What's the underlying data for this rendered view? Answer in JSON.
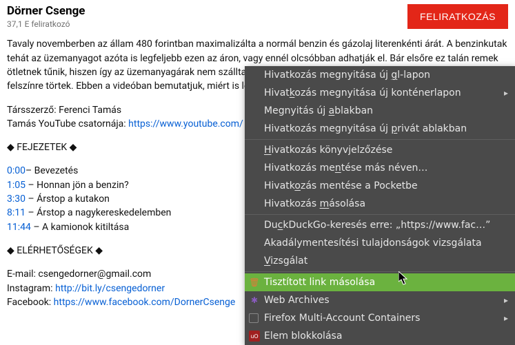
{
  "header": {
    "channel_name": "Dörner Csenge",
    "subs": "37,1 E feliratkozó",
    "subscribe_label": "FELIRATKOZÁS"
  },
  "desc": {
    "paragraph": "Tavaly novemberben az állam 480 forintban maximalizálta a normál benzin és gázolaj literenkénti árát. A benzinkutak tehát az üzemanyagot azóta is legfeljebb ezen az áron, vagy ennél olcsóbban adhatják el. Bár elsőre ez talán remek ötletnek tűnik, hiszen így az üzemanyagárak nem szálltak el, az ár problémái az elmúlt hetekben egyre inkább felszínre törtek. Ebben a videóban bemutatjuk, miért is lehet veszélyes, ha a piaci folyamatokba beleavatkoznak.",
    "coauthor_label": "Társszerző: ",
    "coauthor_name": "Ferenci Tamás",
    "tamas_label": "Tamás YouTube csatornája: ",
    "tamas_link": "https://www.youtube.com/",
    "chapters_heading": "◆ FEJEZETEK ◆",
    "chapters": [
      {
        "t": "0:00",
        "sep": "– ",
        "title": "Bevezetés"
      },
      {
        "t": "1:05",
        "sep": " – ",
        "title": "Honnan jön a benzin?"
      },
      {
        "t": "3:30",
        "sep": " – ",
        "title": "Árstop a kutakon"
      },
      {
        "t": "8:11",
        "sep": " – ",
        "title": "Árstop a nagykereskedelemben"
      },
      {
        "t": "11:44",
        "sep": "  – ",
        "title": "A kamionok kitiltása"
      }
    ],
    "contacts_heading": "◆ ELÉRHETŐSÉGEK ◆",
    "contacts": {
      "email_label": "E-mail: ",
      "email": "csengedorner@gmail.com",
      "instagram_label": "Instagram: ",
      "instagram": "http://bit.ly/csengedorner",
      "facebook_label": "Facebook: ",
      "facebook": "https://www.facebook.com/DornerCsenge"
    }
  },
  "contextmenu": {
    "items": [
      {
        "pre": "Hivatkozás megnyitása új ",
        "u": "",
        "post": "",
        "u2": "g",
        "post2": "l-lapon"
      },
      {
        "pre": "Hivat",
        "u": "k",
        "post": "ozás megnyitása új konténerlapon",
        "arrow": true
      },
      {
        "pre": "Megnyitás új ",
        "u": "a",
        "post": "blakban"
      },
      {
        "pre": "Hivatkozás megnyitása új ",
        "u": "p",
        "post": "rivát ablakban"
      },
      {
        "sep": true
      },
      {
        "pre": "",
        "u": "H",
        "post": "ivatkozás könyvjelzőzése"
      },
      {
        "pre": "Hivatkozás me",
        "u": "n",
        "post": "tése más néven…"
      },
      {
        "pre": "Hivatk",
        "u": "o",
        "post": "zás mentése a Pocketbe"
      },
      {
        "pre": "Hivatkozás ",
        "u": "m",
        "post": "ásolása"
      },
      {
        "sep": true
      },
      {
        "pre": "Du",
        "u": "c",
        "post": "kDuckGo-keresés erre: „https://www.fac…”"
      },
      {
        "pre": "Akadálymentesítési tulajdonságok vizsgálata"
      },
      {
        "pre": "",
        "u": "V",
        "post": "izsgálat"
      },
      {
        "sep": true
      },
      {
        "pre": "Tisztított link másolása",
        "highlight": true,
        "icon_color": "#e07b3a",
        "icon": "🗑"
      },
      {
        "pre": "Web Archives",
        "arrow": true,
        "icon_color": "#8a5bbf",
        "icon": "✱"
      },
      {
        "pre": "Firefox Multi-Account Containers",
        "arrow": true,
        "icon_box": true
      },
      {
        "pre": "Elem blokkolása",
        "icon_color": "#a02020",
        "icon_bg": true
      }
    ]
  }
}
